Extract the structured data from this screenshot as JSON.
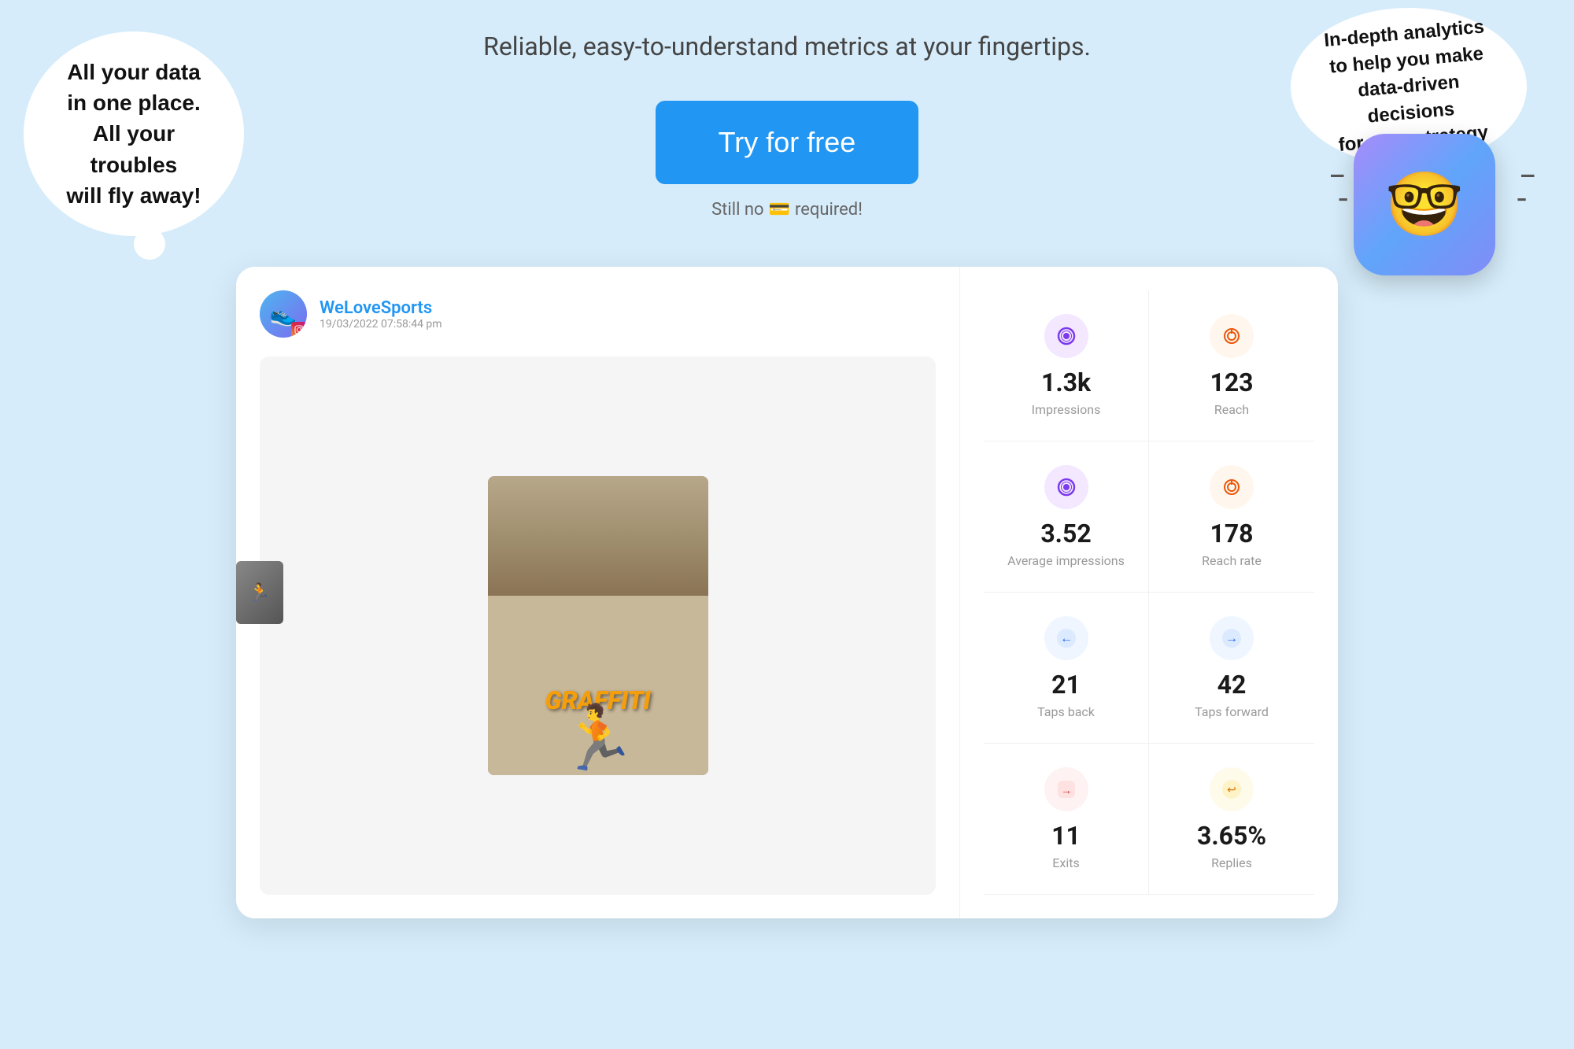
{
  "hero": {
    "subtitle": "Reliable, easy-to-understand metrics at your fingertips.",
    "cta_button": "Try for free",
    "no_card_text": "Still no",
    "no_card_suffix": "required!",
    "card_emoji": "💳"
  },
  "speech_left": {
    "line1": "All your data",
    "line2": "in one place.",
    "line3": "All your troubles",
    "line4": "will fly away!"
  },
  "speech_right": {
    "text": "In-depth analytics to help you make data-driven decisions for your strategy"
  },
  "mascot": {
    "aria": "Analytics mascot with glasses"
  },
  "post": {
    "username": "WeLoveSports",
    "timestamp": "19/03/2022 07:58:44 pm",
    "platform": "instagram"
  },
  "metrics": [
    {
      "value": "1.3k",
      "label": "Impressions",
      "icon_type": "purple",
      "icon_symbol": "⊙"
    },
    {
      "value": "123",
      "label": "Reach",
      "icon_type": "orange",
      "icon_symbol": "◎"
    },
    {
      "value": "3.52",
      "label": "Average impressions",
      "icon_type": "purple",
      "icon_symbol": "⊙"
    },
    {
      "value": "178",
      "label": "Reach rate",
      "icon_type": "orange",
      "icon_symbol": "◎"
    },
    {
      "value": "21",
      "label": "Taps back",
      "icon_type": "blue",
      "icon_symbol": "←"
    },
    {
      "value": "42",
      "label": "Taps forward",
      "icon_type": "blue-forward",
      "icon_symbol": "→"
    },
    {
      "value": "11",
      "label": "Exits",
      "icon_type": "red",
      "icon_symbol": "→"
    },
    {
      "value": "3.65%",
      "label": "Replies",
      "icon_type": "amber",
      "icon_symbol": "↩"
    }
  ]
}
